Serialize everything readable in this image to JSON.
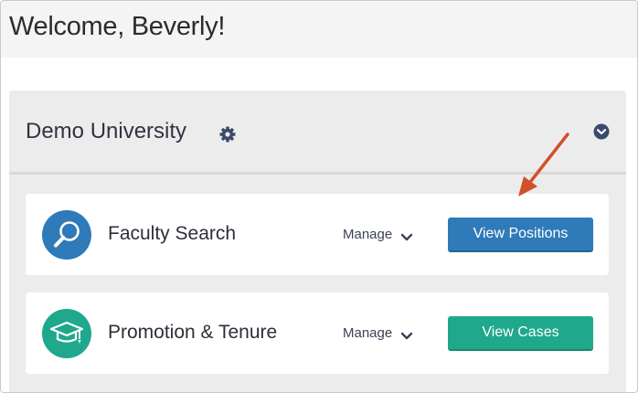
{
  "header": {
    "welcome_text": "Welcome, Beverly!"
  },
  "org": {
    "name": "Demo University",
    "settings_icon": "gear-icon",
    "collapse_icon": "chevron-circle-down-icon"
  },
  "cards": [
    {
      "title": "Faculty Search",
      "icon": "magnifier-icon",
      "icon_color": "#2f7ab8",
      "manage_label": "Manage",
      "button_label": "View Positions",
      "button_color": "#2f7ab8"
    },
    {
      "title": "Promotion & Tenure",
      "icon": "graduation-cap-icon",
      "icon_color": "#1fa88c",
      "manage_label": "Manage",
      "button_label": "View Cases",
      "button_color": "#1fa88c"
    }
  ],
  "colors": {
    "annotation_arrow": "#d2502c",
    "primary_blue": "#2f7ab8",
    "teal": "#1fa88c"
  }
}
